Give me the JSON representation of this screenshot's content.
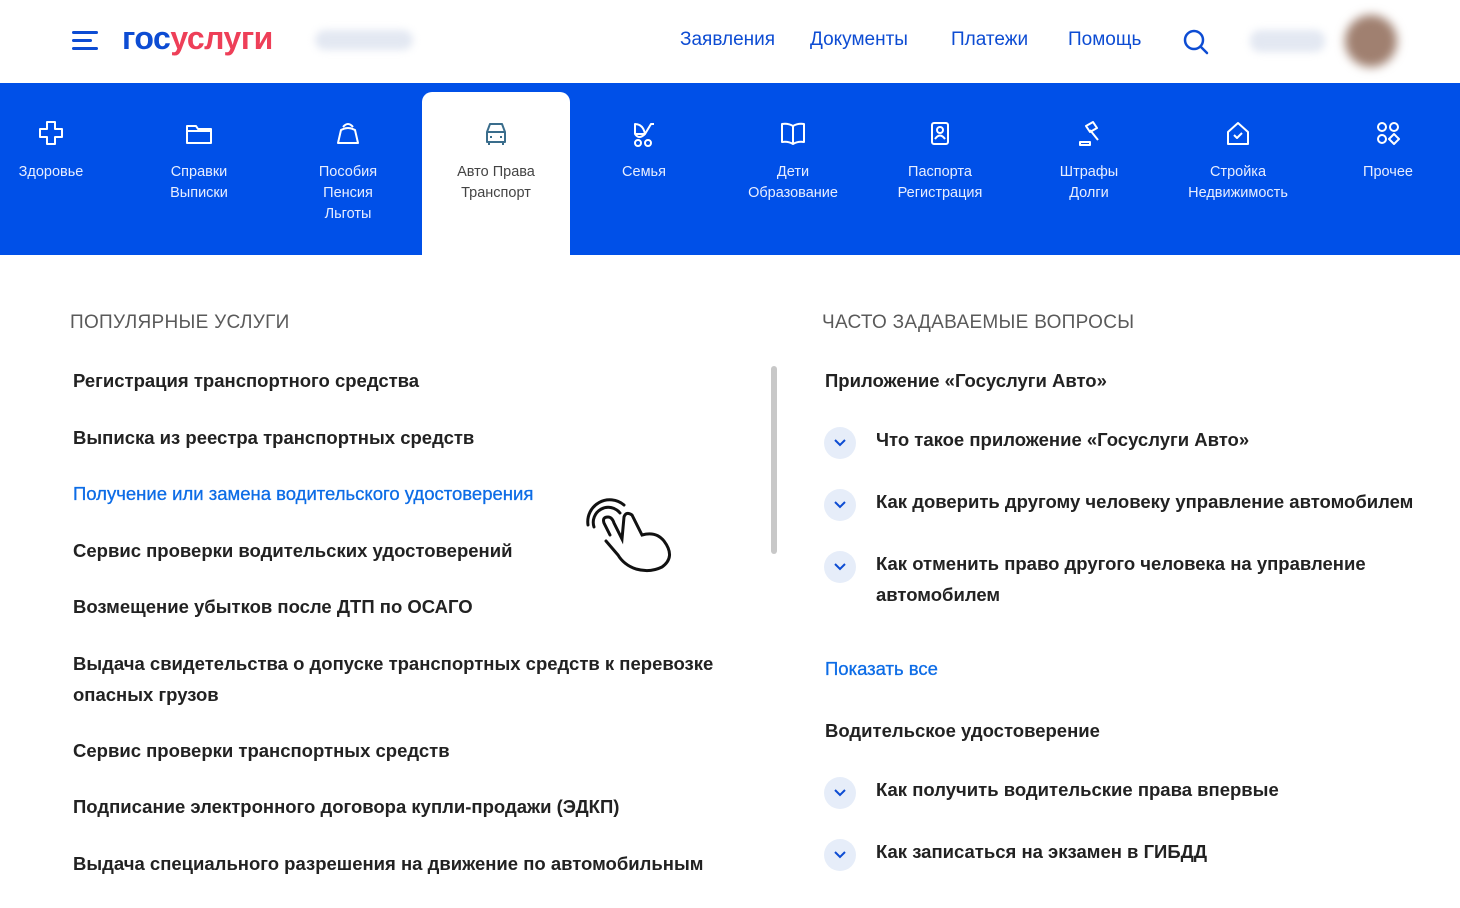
{
  "header": {
    "logo_part1": "гос",
    "logo_part2": "услуги",
    "nav": [
      "Заявления",
      "Документы",
      "Платежи",
      "Помощь"
    ]
  },
  "colors": {
    "brand_blue": "#0050e8",
    "link": "#0d4cd3",
    "logo_red": "#ee3f58"
  },
  "categories": [
    {
      "label": "Здоровье",
      "icon": "medical-cross-icon"
    },
    {
      "label": "Справки\nВыписки",
      "icon": "folder-icon"
    },
    {
      "label": "Пособия\nПенсия\nЛьготы",
      "icon": "purse-icon"
    },
    {
      "label": "Авто Права\nТранспорт",
      "icon": "car-icon",
      "active": true
    },
    {
      "label": "Семья",
      "icon": "stroller-icon"
    },
    {
      "label": "Дети\nОбразование",
      "icon": "book-icon"
    },
    {
      "label": "Паспорта\nРегистрация",
      "icon": "passport-icon"
    },
    {
      "label": "Штрафы\nДолги",
      "icon": "gavel-icon"
    },
    {
      "label": "Стройка\nНедвижимость",
      "icon": "house-icon"
    },
    {
      "label": "Прочее",
      "icon": "grid-icon"
    }
  ],
  "popular": {
    "title": "ПОПУЛЯРНЫЕ УСЛУГИ",
    "items": [
      "Регистрация транспортного средства",
      "Выписка из реестра транспортных средств",
      "Получение или замена водительского удостоверения",
      "Сервис проверки водительских удостоверений",
      "Возмещение убытков после ДТП по ОСАГО",
      "Выдача свидетельства о допуске транспортных средств к перевозке опасных грузов",
      "Сервис проверки транспортных средств",
      "Подписание электронного договора купли-продажи (ЭДКП)",
      "Выдача специального разрешения на движение по автомобильным"
    ]
  },
  "faq": {
    "title": "ЧАСТО ЗАДАВАЕМЫЕ ВОПРОСЫ",
    "group1": "Приложение «Госуслуги Авто»",
    "q1": [
      "Что такое приложение «Госуслуги Авто»",
      "Как доверить другому человеку управление автомобилем",
      "Как отменить право другого человека на управление автомобилем"
    ],
    "show_all": "Показать все",
    "group2": "Водительское удостоверение",
    "q2": [
      "Как получить водительские права впервые",
      "Как записаться на экзамен в ГИБДД"
    ]
  }
}
